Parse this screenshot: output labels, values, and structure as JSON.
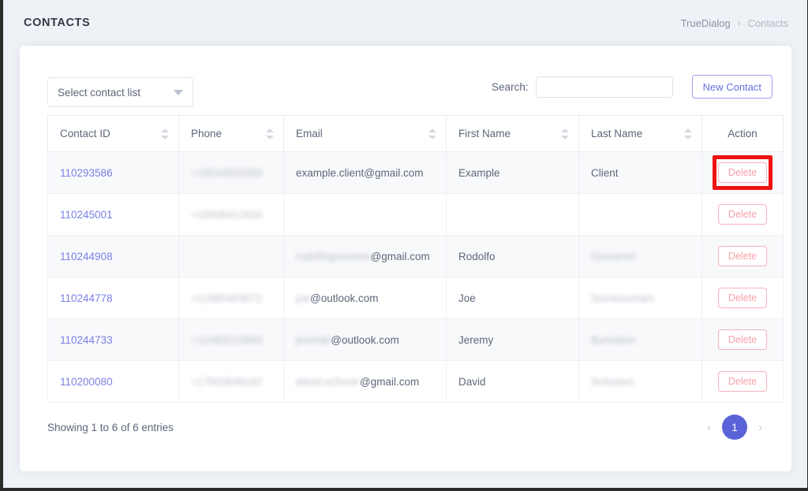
{
  "header": {
    "title": "CONTACTS",
    "breadcrumb": {
      "root": "TrueDialog",
      "separator": "›",
      "current": "Contacts"
    }
  },
  "toolbar": {
    "contact_list_select": {
      "selected_label": "Select contact list",
      "caret_icon": "chevron-down-icon"
    },
    "search": {
      "label": "Search:",
      "value": "",
      "placeholder": ""
    },
    "new_contact_label": "New Contact"
  },
  "table": {
    "columns": [
      {
        "label": "Contact ID",
        "sortable": true
      },
      {
        "label": "Phone",
        "sortable": true
      },
      {
        "label": "Email",
        "sortable": true
      },
      {
        "label": "First Name",
        "sortable": true
      },
      {
        "label": "Last Name",
        "sortable": true
      },
      {
        "label": "Action",
        "sortable": false
      }
    ],
    "action_label": "Delete",
    "rows": [
      {
        "contact_id": "110293586",
        "phone": "+19544833268",
        "phone_redacted": true,
        "email": "example.client@gmail.com",
        "email_redacted_prefix": "",
        "first_name": "Example",
        "last_name": "Client",
        "last_name_redacted": false,
        "highlighted": true
      },
      {
        "contact_id": "110245001",
        "phone": "+19406412434",
        "phone_redacted": true,
        "email": "",
        "email_redacted_prefix": "",
        "first_name": "",
        "last_name": "",
        "last_name_redacted": false,
        "highlighted": false
      },
      {
        "contact_id": "110244908",
        "phone": "",
        "phone_redacted": false,
        "email": "@gmail.com",
        "email_redacted_prefix": "rodolfogiovanini",
        "first_name": "Rodolfo",
        "last_name": "Giovanini",
        "last_name_redacted": true,
        "highlighted": false
      },
      {
        "contact_id": "110244778",
        "phone": "+12485403072",
        "phone_redacted": true,
        "email": "@outlook.com",
        "email_redacted_prefix": "joe",
        "first_name": "Joe",
        "last_name": "Somesurnam",
        "last_name_redacted": true,
        "highlighted": false
      },
      {
        "contact_id": "110244733",
        "phone": "+12483215860",
        "phone_redacted": true,
        "email": "@outlook.com",
        "email_redacted_prefix": "jerembi",
        "first_name": "Jeremy",
        "last_name": "Burnstein",
        "last_name_redacted": true,
        "highlighted": false
      },
      {
        "contact_id": "110200080",
        "phone": "+17603848182",
        "phone_redacted": true,
        "email": "@gmail.com",
        "email_redacted_prefix": "david.schorer",
        "first_name": "David",
        "last_name": "Schonert",
        "last_name_redacted": true,
        "highlighted": false
      }
    ]
  },
  "footer": {
    "entries_info": "Showing 1 to 6 of 6 entries",
    "pagination": {
      "prev_icon": "‹",
      "next_icon": "›",
      "current_page": "1"
    }
  },
  "colors": {
    "accent": "#5a63d8",
    "link": "#7a80e4",
    "danger": "#f8a0ab",
    "highlight": "#ee1111",
    "page_bg": "#eef1f5"
  }
}
